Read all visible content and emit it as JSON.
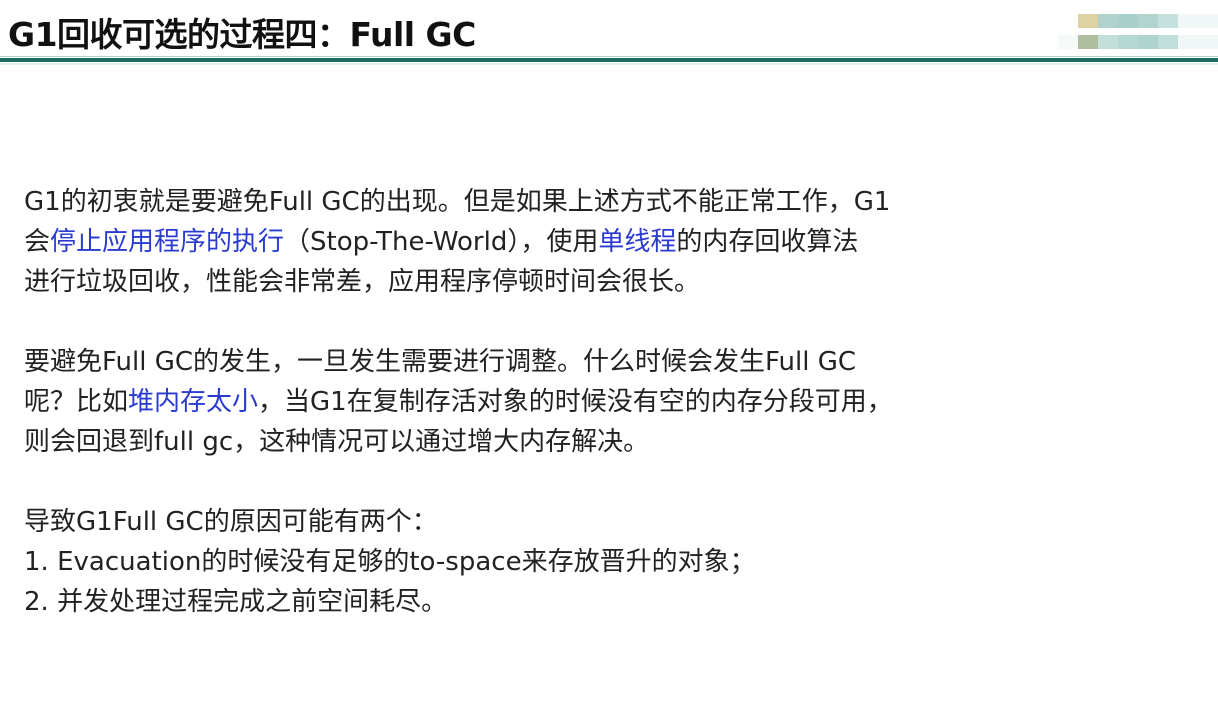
{
  "slide": {
    "title": "G1回收可选的过程四：Full GC",
    "accent_color": "#1d6c64",
    "highlight_color": "#2b3bd1",
    "paragraphs": [
      [
        [
          {
            "t": "G1的初衷就是要避免Full GC的出现。但是如果上述方式不能正常工作，G1"
          }
        ],
        [
          {
            "t": "会"
          },
          {
            "t": "停止应用程序的执行",
            "hl": true
          },
          {
            "t": "（Stop-The-World），使用"
          },
          {
            "t": "单线程",
            "hl": true
          },
          {
            "t": "的内存回收算法"
          }
        ],
        [
          {
            "t": "进行垃圾回收，性能会非常差，应用程序停顿时间会很长。"
          }
        ]
      ],
      [
        [
          {
            "t": "要避免Full GC的发生，一旦发生需要进行调整。什么时候会发生Full GC"
          }
        ],
        [
          {
            "t": "呢？比如"
          },
          {
            "t": "堆内存太小",
            "hl": true
          },
          {
            "t": "，当G1在复制存活对象的时候没有空的内存分段可用，"
          }
        ],
        [
          {
            "t": "则会回退到full gc，这种情况可以通过增大内存解决。"
          }
        ]
      ],
      [
        [
          {
            "t": "导致G1Full GC的原因可能有两个："
          }
        ],
        [
          {
            "t": "1. Evacuation的时候没有足够的to-space来存放晋升的对象；"
          }
        ],
        [
          {
            "t": "2. 并发处理过程完成之前空间耗尽。"
          }
        ]
      ]
    ]
  }
}
